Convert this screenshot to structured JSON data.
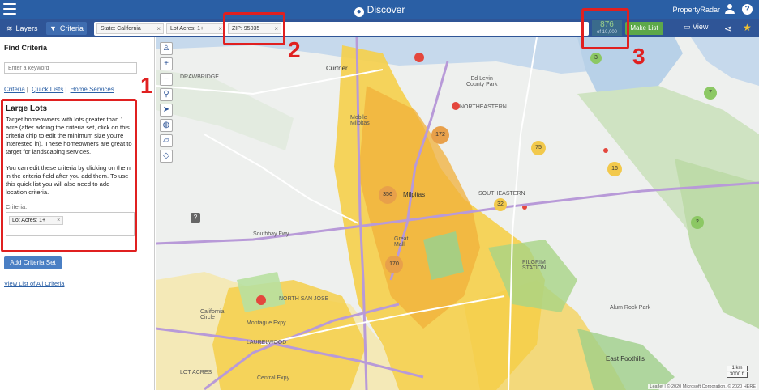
{
  "app": {
    "title": "Discover",
    "brand": "PropertyRadar"
  },
  "toolbar": {
    "layers_label": "Layers",
    "criteria_label": "Criteria",
    "chips": [
      {
        "label": "State: California"
      },
      {
        "label": "Lot Acres: 1+"
      },
      {
        "label": "ZIP: 95035"
      }
    ],
    "count": "876",
    "count_sub": "of 10,000",
    "make_list_label": "Make List",
    "view_label": "View"
  },
  "sidebar": {
    "heading": "Find Criteria",
    "search_placeholder": "Enter a keyword",
    "tabs": [
      "Criteria",
      "Quick Lists",
      "Home Services"
    ],
    "quick_list": {
      "title": "Large Lots",
      "description": "Target homeowners with lots greater than 1 acre (after adding the criteria set, click on this criteria chip to edit the minimum size you're interested in). These homeowners are great to target for landscaping services.\n\nYou can edit these criteria by clicking on them in the criteria field after you add them. To use this quick list you will also need to add location criteria.",
      "criteria_label": "Criteria:",
      "criteria_chip": "Lot Acres: 1+"
    },
    "add_button": "Add Criteria Set",
    "view_all_link": "View List of All Criteria"
  },
  "annotations": [
    "1",
    "2",
    "3"
  ],
  "map": {
    "clusters": [
      {
        "label": "3",
        "color": "#8cc864"
      },
      {
        "label": "7",
        "color": "#8cc864"
      },
      {
        "label": "172",
        "color": "#e8a04a"
      },
      {
        "label": "75",
        "color": "#f2c94c"
      },
      {
        "label": "16",
        "color": "#f2c94c"
      },
      {
        "label": "356",
        "color": "#e8a04a"
      },
      {
        "label": "32",
        "color": "#f2c94c"
      },
      {
        "label": "2",
        "color": "#8cc864"
      },
      {
        "label": "170",
        "color": "#e8a04a"
      }
    ],
    "labels": {
      "curtner": "Curtner",
      "drawbridge": "DRAWBRIDGE",
      "milpitas": "Milpitas",
      "mobile_milpitas": "Mobile\nMilpitas",
      "ed_levin": "Ed Levin\nCounty Park",
      "northeastern": "NORTHEASTERN",
      "southeastern": "SOUTHEASTERN",
      "southbay": "Southbay Fwy",
      "great_mall": "Great\nMall",
      "california_circle": "California\nCircle",
      "north_san_jose": "NORTH SAN JOSE",
      "laurelwood": "LAURELWOOD",
      "lot_acres": "LOT ACRES",
      "montague": "Montague Expy",
      "central_expy": "Central Expy",
      "alum_rock": "Alum Rock Park",
      "east_foothills": "East Foothills",
      "pilgrim": "PILGRIM\nSTATION",
      "east_hills": "EAST"
    },
    "scale_km": "1 km",
    "scale_ft": "3000 ft",
    "attribution": "Leaflet | © 2020 Microsoft Corporation, © 2020 HERE"
  }
}
